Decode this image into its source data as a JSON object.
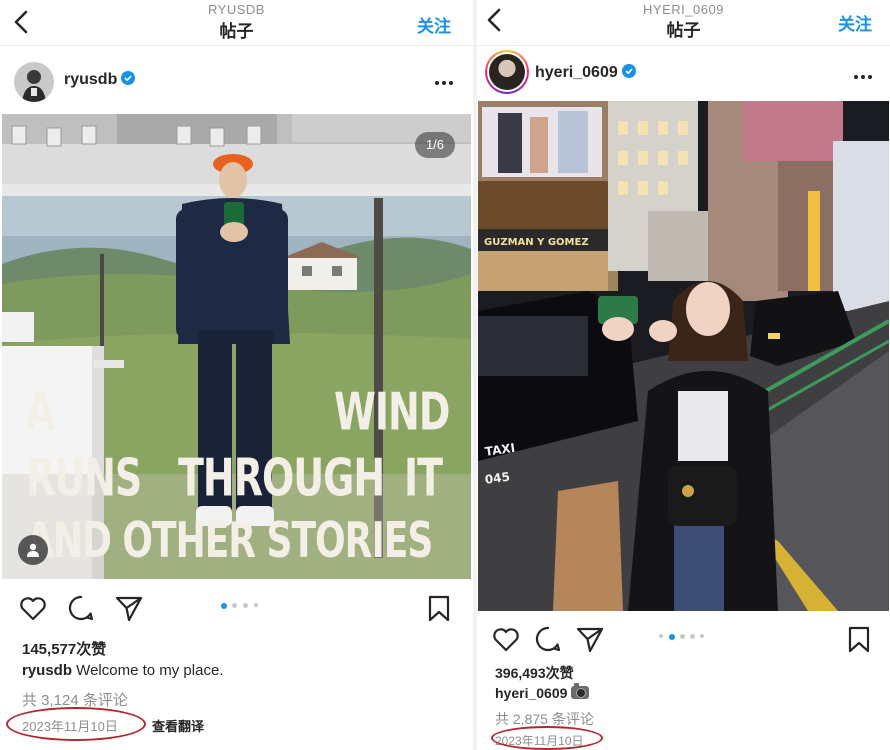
{
  "posts": [
    {
      "header": {
        "account": "RYUSDB",
        "title": "帖子",
        "follow_label": "关注"
      },
      "user": {
        "username": "ryusdb",
        "verified": true
      },
      "media": {
        "counter": "1/6",
        "overlay_lines": [
          "A",
          "WIND",
          "RUNS",
          "THROUGH",
          "IT",
          "AND OTHER STORIES"
        ],
        "carousel_dots": 4,
        "active_dot": 0
      },
      "likes": "145,577次赞",
      "caption": {
        "username": "ryusdb",
        "text": " Welcome to my place."
      },
      "comments": "共 3,124 条评论",
      "date": "2023年11月10日",
      "translate_label": "查看翻译"
    },
    {
      "header": {
        "account": "HYERI_0609",
        "title": "帖子",
        "follow_label": "关注"
      },
      "user": {
        "username": "hyeri_0609",
        "verified": true
      },
      "media": {
        "taxi_text": "TAXI",
        "taxi_number": "045",
        "store_sign": "GUZMAN Y GOMEZ",
        "carousel_dots": 5,
        "active_dot": 1
      },
      "likes": "396,493次赞",
      "caption": {
        "username": "hyeri_0609",
        "emoji": "camera-with-flash"
      },
      "comments": "共 2,875 条评论",
      "date": "2023年11月10日"
    }
  ],
  "colors": {
    "accent": "#1a91e8",
    "annotation_circle": "#b3282d",
    "muted_text": "#8e8e8e"
  }
}
